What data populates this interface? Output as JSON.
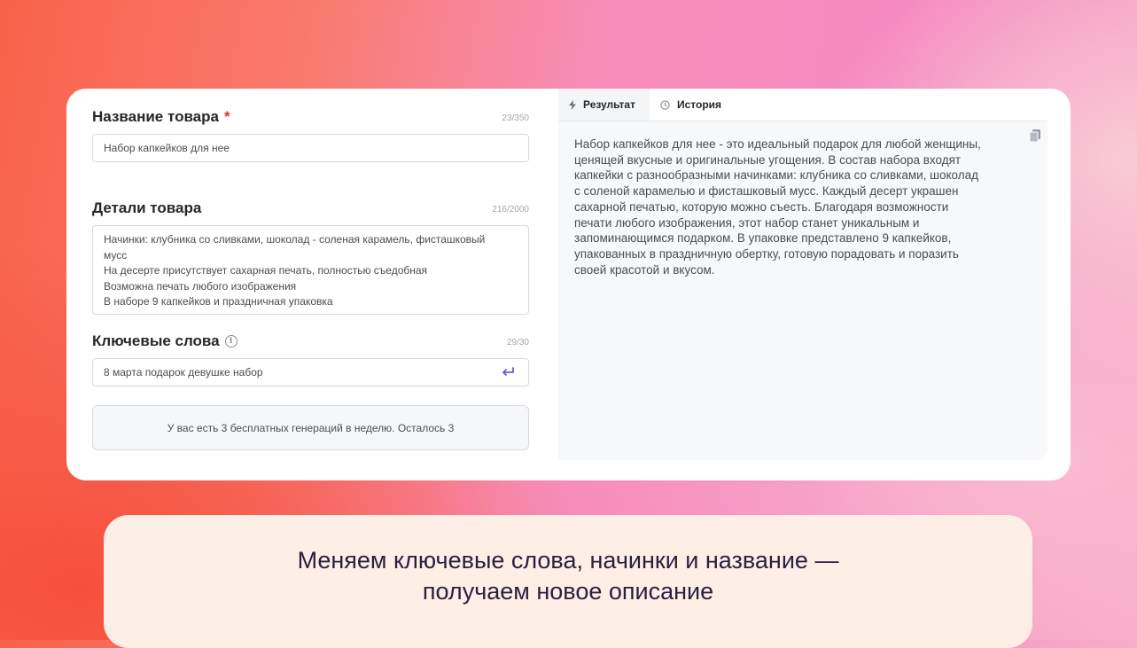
{
  "form": {
    "title_field": {
      "label": "Название товара",
      "required_mark": "*",
      "counter": "23/350",
      "value": "Набор капкейков для нее"
    },
    "details_field": {
      "label": "Детали товара",
      "counter": "216/2000",
      "lines": [
        "Начинки: клубника со сливками, шоколад - соленая карамель, фисташковый",
        "мусс",
        "На десерте присутствует сахарная печать, полностью съедобная",
        "Возможна печать любого изображения",
        "В наборе 9 капкейков и праздничная упаковка"
      ]
    },
    "keywords_field": {
      "label": "Ключевые слова",
      "info_glyph": "i",
      "counter": "29/30",
      "value": "8 марта подарок девушке набор"
    },
    "notice": "У вас есть 3 бесплатных генераций в неделю. Осталось 3"
  },
  "tabs": [
    {
      "label": "Результат",
      "icon": "bolt-icon",
      "active": true
    },
    {
      "label": "История",
      "icon": "clock-icon",
      "active": false
    }
  ],
  "result": {
    "lines": [
      "Набор капкейков для нее - это идеальный подарок для любой женщины,",
      "ценящей вкусные и оригинальные угощения. В состав набора входят",
      "капкейки с разнообразными начинками: клубника со сливками, шоколад",
      "с соленой карамелью и фисташковый мусс. Каждый десерт украшен",
      "сахарной печатью, которую можно съесть. Благодаря возможности",
      "печати любого изображения, этот набор станет уникальным и",
      "запоминающимся подарком. В упаковке представлено 9 капкейков,",
      "упакованных в праздничную обертку, готовую порадовать и поразить",
      "своей красотой и вкусом."
    ]
  },
  "caption": {
    "line1": "Меняем ключевые слова, начинки и название —",
    "line2": "получаем новое описание"
  },
  "colors": {
    "accent": "#6f5bd6",
    "required": "#e8263a"
  }
}
